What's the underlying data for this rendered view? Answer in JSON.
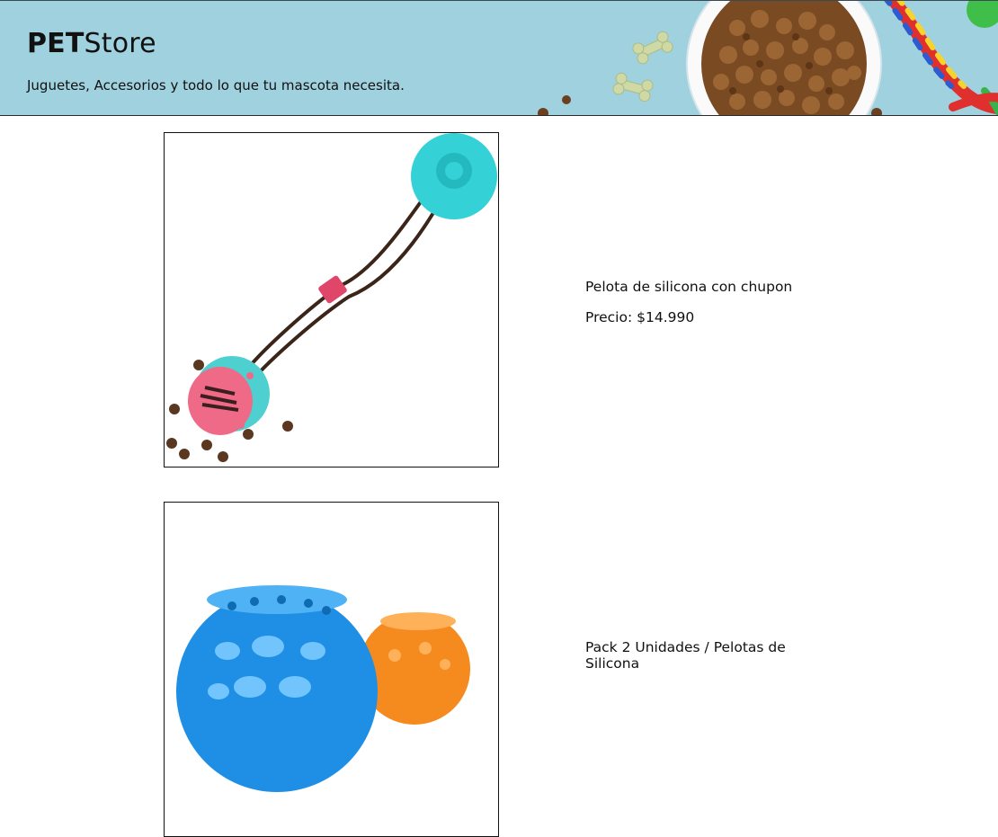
{
  "header": {
    "brand_strong": "PET",
    "brand_light": "Store",
    "tagline": "Juguetes, Accesorios y todo lo que tu mascota necesita."
  },
  "products": [
    {
      "name": "Pelota de silicona con chupon",
      "price": "Precio: $14.990",
      "image_icon": "suction-rope-ball-toy"
    },
    {
      "name": "Pack 2 Unidades / Pelotas de Silicona",
      "image_icon": "blue-orange-silicone-balls"
    }
  ],
  "colors": {
    "header_bg": "#9fd1df",
    "suction_cup": "#2ed3d6",
    "ball_pink": "#f06b86",
    "blue_ball": "#1f8fe6",
    "orange_ball": "#f58a1f"
  }
}
